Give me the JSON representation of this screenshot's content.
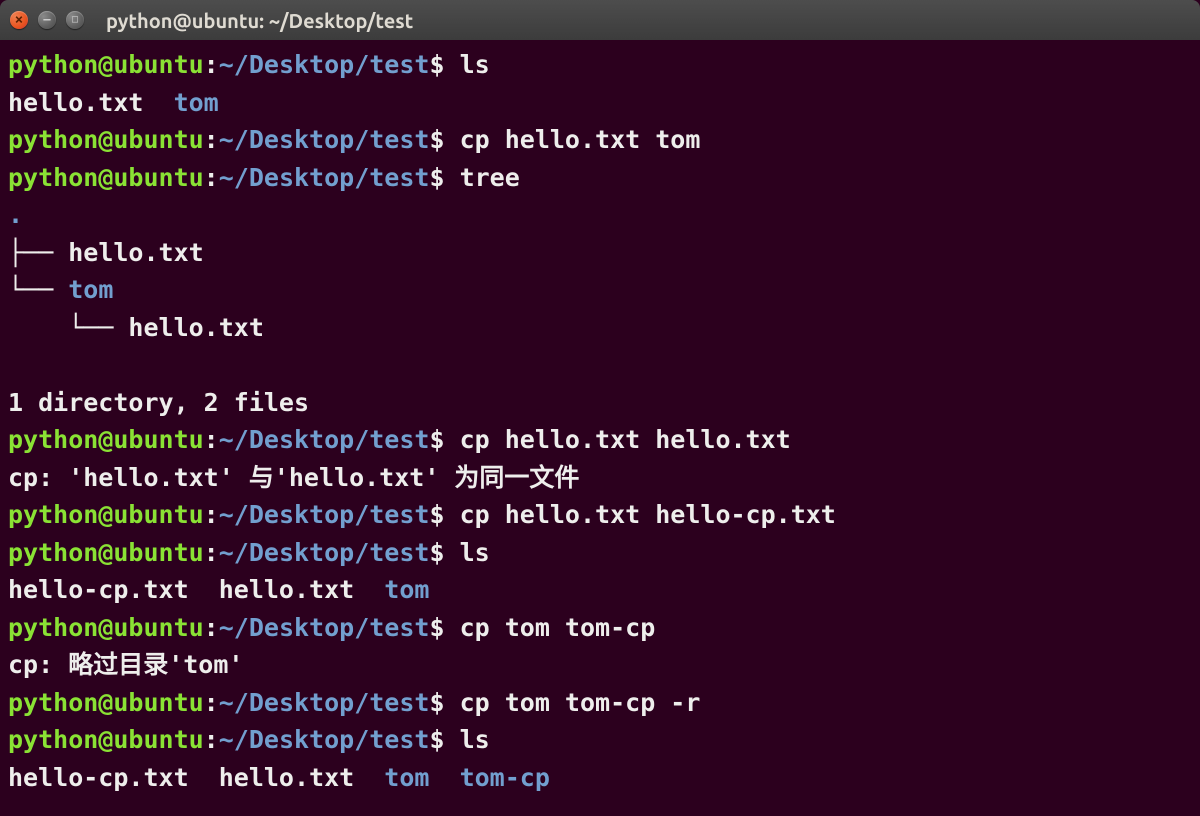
{
  "window": {
    "title": "python@ubuntu: ~/Desktop/test"
  },
  "prompt": {
    "user": "python@ubuntu",
    "colon": ":",
    "path": "~/Desktop/test",
    "symbol": "$"
  },
  "lines": {
    "cmd1": "ls",
    "out1a": "hello.txt  ",
    "out1b": "tom",
    "cmd2": "cp hello.txt tom",
    "cmd3": "tree",
    "tree_dot": ".",
    "tree1_bar": "├── ",
    "tree1_txt": "hello.txt",
    "tree2_bar": "└── ",
    "tree2_txt": "tom",
    "tree3_bar": "    └── ",
    "tree3_txt": "hello.txt",
    "tree_summary": "1 directory, 2 files",
    "cmd4": "cp hello.txt hello.txt",
    "err4": "cp: 'hello.txt' 与'hello.txt' 为同一文件",
    "cmd5": "cp hello.txt hello-cp.txt",
    "cmd6": "ls",
    "out6a": "hello-cp.txt  hello.txt  ",
    "out6b": "tom",
    "cmd7": "cp tom tom-cp",
    "err7": "cp: 略过目录'tom'",
    "cmd8": "cp tom tom-cp -r",
    "cmd9": "ls",
    "out9a": "hello-cp.txt  hello.txt  ",
    "out9b": "tom",
    "out9c": "  ",
    "out9d": "tom-cp"
  }
}
